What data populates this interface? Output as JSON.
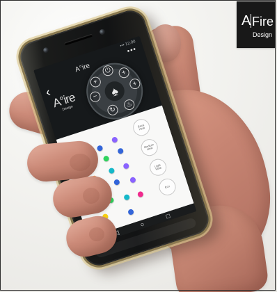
{
  "watermark": {
    "a": "A",
    "fire": "Fire",
    "design": "Design"
  },
  "phone": {
    "status": "••• 12:00",
    "top_menu": "•••",
    "app_mark": "A°ire",
    "back_icon": "‹",
    "brand": {
      "mark": "A°ire",
      "sub": "Design"
    },
    "dial": {
      "power_icon": "⏻",
      "plus_icon": "+",
      "minus_icon": "−",
      "flame_icon": "♨",
      "center_icon": "♠",
      "sync_icon": "↻"
    },
    "mode_buttons": [
      {
        "label": "Extra\nHeat"
      },
      {
        "label": "Medium\nHeat"
      },
      {
        "label": "Light\nHeat"
      },
      {
        "label": "Eco"
      }
    ],
    "nav": {
      "back": "◁",
      "home": "○",
      "recent": "□"
    }
  },
  "colors": {
    "red": "#f02824",
    "orange": "#ff8a1d",
    "yellow": "#f6ce13",
    "green": "#2fd35d",
    "teal": "#14b8c9",
    "blue": "#3365d9",
    "violet": "#8a63ff",
    "pink": "#f02b8e"
  }
}
